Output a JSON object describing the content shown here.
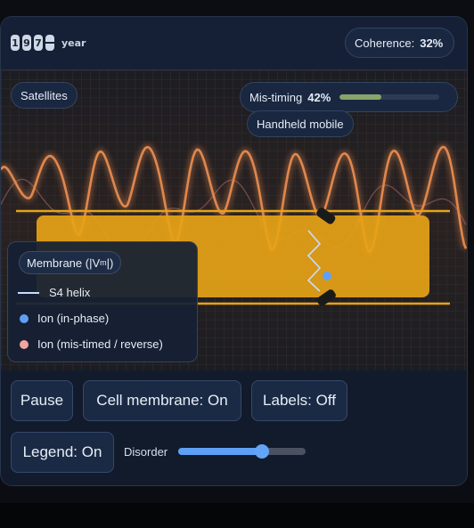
{
  "header": {
    "year_digits": [
      "1",
      "9",
      "7",
      "0"
    ],
    "year_label": "year",
    "coherence_label": "Coherence:",
    "coherence_value": "32%"
  },
  "viz": {
    "satellites_label": "Satellites",
    "mistiming_label": "Mis-timing",
    "mistiming_value": "42%",
    "mistiming_level": 0.42,
    "handheld_label": "Handheld mobile"
  },
  "legend": {
    "title": "Membrane (|V",
    "title_sub": "m",
    "title_end": "|)",
    "items": [
      {
        "label": "S4 helix",
        "color": "#c8dcff"
      },
      {
        "label": "Ion (in-phase)",
        "color": "#5ea0f5"
      },
      {
        "label": "Ion (mis-timed / reverse)",
        "color": "#f2a3a0"
      }
    ]
  },
  "controls": {
    "pause": "Pause",
    "membrane": "Cell membrane: On",
    "labels": "Labels: Off",
    "legend": "Legend: On",
    "disorder_label": "Disorder",
    "disorder_value": 0.66
  },
  "colors": {
    "membrane": "#e6a317",
    "wave": "#e0874d",
    "ion_in_phase": "#5ea0f5",
    "ion_mistimed": "#f2a3a0",
    "accent": "#62a4f7"
  }
}
